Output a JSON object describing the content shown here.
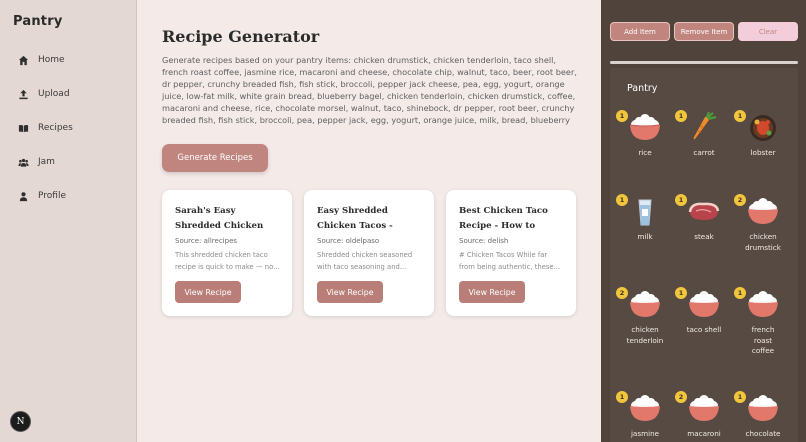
{
  "sidebar": {
    "brand": "Pantry",
    "items": [
      {
        "label": "Home",
        "icon": "home-icon"
      },
      {
        "label": "Upload",
        "icon": "upload-icon"
      },
      {
        "label": "Recipes",
        "icon": "book-icon"
      },
      {
        "label": "Jam",
        "icon": "people-icon"
      },
      {
        "label": "Profile",
        "icon": "person-icon"
      }
    ],
    "avatar_letter": "N"
  },
  "main": {
    "title": "Recipe Generator",
    "description": "Generate recipes based on your pantry items: chicken drumstick, chicken tenderloin, taco shell, french roast coffee, jasmine rice, macaroni and cheese, chocolate chip, walnut, taco, beer, root beer, dr pepper, crunchy breaded fish, fish stick, broccoli, pepper jack cheese, pea, egg, yogurt, orange juice, low-fat milk, white grain bread, blueberry bagel, chicken tenderloin, chicken drumstick, coffee, macaroni and cheese, rice, chocolate morsel, walnut, taco, shinebock, dr pepper, root beer, crunchy breaded fish, fish stick, broccoli, pea, pepper jack, egg, yogurt, orange juice, milk, bread, blueberry",
    "generate_label": "Generate Recipes",
    "cards": [
      {
        "title": "Sarah's Easy Shredded Chicken Taco Filling...",
        "source": "Source: allrecipes",
        "snippet": "This shredded chicken taco recipe is quick to make — no...",
        "button": "View Recipe"
      },
      {
        "title": "Easy Shredded Chicken Tacos - Mexican...",
        "source": "Source: oldelpaso",
        "snippet": "Shredded chicken seasoned with taco seasoning and...",
        "button": "View Recipe"
      },
      {
        "title": "Best Chicken Taco Recipe - How to Make...",
        "source": "Source: delish",
        "snippet": "# Chicken Tacos While far from being authentic, these...",
        "button": "View Recipe"
      }
    ]
  },
  "panel": {
    "add_label": "Add Item",
    "remove_label": "Remove Item",
    "clear_label": "Clear",
    "pantry_title": "Pantry",
    "items": [
      {
        "label": "rice",
        "count": "1",
        "icon": "rice-bowl-icon"
      },
      {
        "label": "carrot",
        "count": "1",
        "icon": "carrot-icon"
      },
      {
        "label": "lobster",
        "count": "1",
        "icon": "lobster-dish-icon"
      },
      {
        "label": "milk",
        "count": "1",
        "icon": "milk-glass-icon"
      },
      {
        "label": "steak",
        "count": "1",
        "icon": "steak-icon"
      },
      {
        "label": "chicken drumstick",
        "count": "2",
        "icon": "rice-bowl-icon"
      },
      {
        "label": "chicken tenderloin",
        "count": "2",
        "icon": "rice-bowl-icon"
      },
      {
        "label": "taco shell",
        "count": "1",
        "icon": "rice-bowl-icon"
      },
      {
        "label": "french roast coffee",
        "count": "1",
        "icon": "rice-bowl-icon"
      },
      {
        "label": "jasmine",
        "count": "1",
        "icon": "rice-bowl-icon"
      },
      {
        "label": "macaroni",
        "count": "2",
        "icon": "rice-bowl-icon"
      },
      {
        "label": "chocolate",
        "count": "1",
        "icon": "rice-bowl-icon"
      }
    ]
  }
}
